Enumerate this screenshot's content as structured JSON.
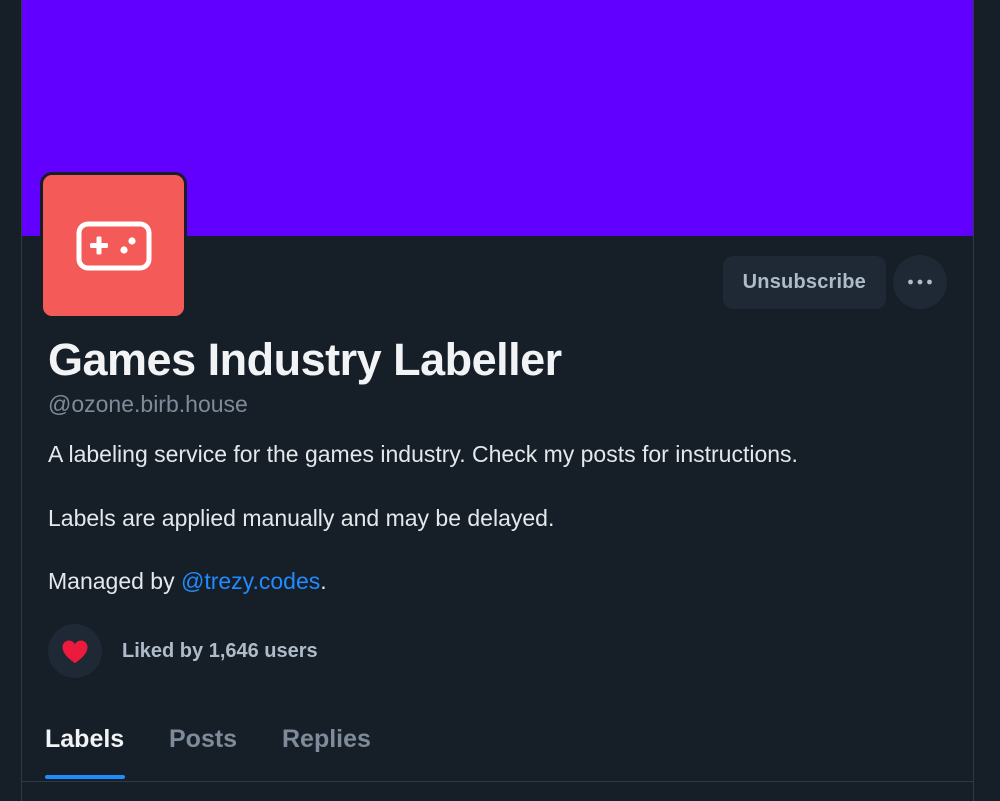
{
  "profile": {
    "banner_color": "#6100ff",
    "avatar": {
      "icon": "gamepad-icon",
      "background": "#f45a57"
    },
    "display_name": "Games Industry Labeller",
    "handle": "@ozone.birb.house",
    "description": {
      "line1": "A labeling service for the games industry. Check my posts for instructions.",
      "line2": "Labels are applied manually and may be delayed.",
      "line3_prefix": "Managed by ",
      "line3_mention": "@trezy.codes",
      "line3_suffix": "."
    }
  },
  "actions": {
    "unsubscribe_label": "Unsubscribe",
    "more_icon": "ellipsis-icon"
  },
  "likes": {
    "icon": "heart-icon",
    "text": "Liked by 1,646 users",
    "heart_color": "#ec1b3e"
  },
  "tabs": [
    {
      "label": "Labels",
      "active": true
    },
    {
      "label": "Posts",
      "active": false
    },
    {
      "label": "Replies",
      "active": false
    }
  ],
  "colors": {
    "accent": "#208bfe",
    "background": "#161e27"
  }
}
